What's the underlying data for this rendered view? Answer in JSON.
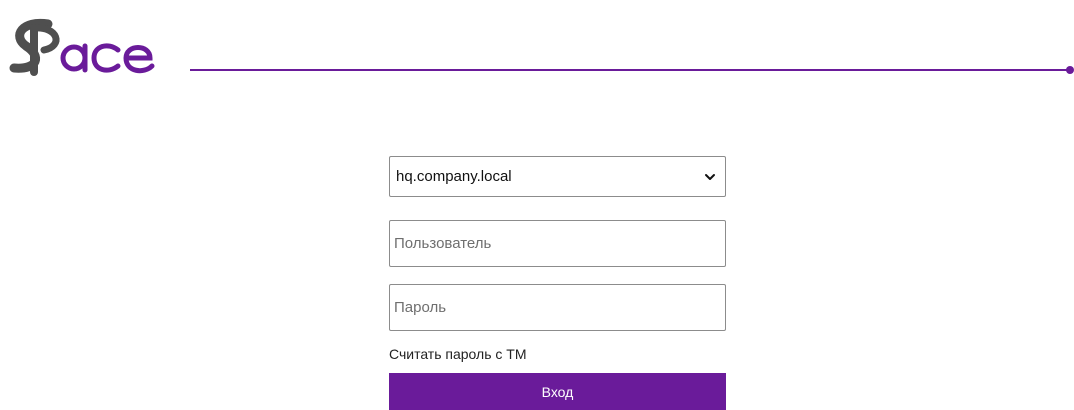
{
  "brand": {
    "name": "SPace",
    "logo_letters": "Sace",
    "accent_color": "#6a1b9a",
    "gray_color": "#4f4f4f"
  },
  "login": {
    "domain_select": {
      "selected": "hq.company.local",
      "options": [
        "hq.company.local"
      ]
    },
    "username": {
      "value": "",
      "placeholder": "Пользователь"
    },
    "password": {
      "value": "",
      "placeholder": "Пароль"
    },
    "tm_link_label": "Считать пароль с ТМ",
    "submit_label": "Вход"
  },
  "icons": {
    "select_chevron": "chevron-down-icon"
  }
}
